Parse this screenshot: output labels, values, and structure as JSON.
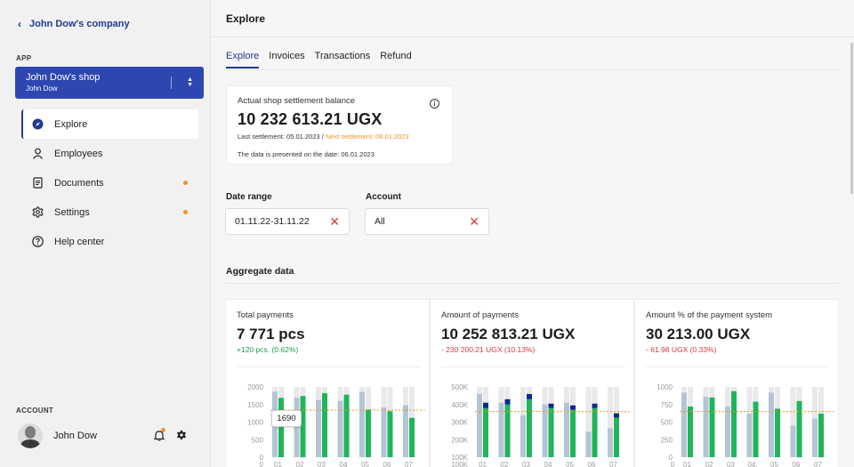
{
  "sidebar": {
    "company": "John Dow's company",
    "app_label": "APP",
    "shop": {
      "name": "John Dow's shop",
      "owner": "John Dow"
    },
    "nav": [
      {
        "label": "Explore",
        "icon": "compass-icon",
        "active": true,
        "dot": false
      },
      {
        "label": "Employees",
        "icon": "person-icon",
        "active": false,
        "dot": false
      },
      {
        "label": "Documents",
        "icon": "document-icon",
        "active": false,
        "dot": true
      },
      {
        "label": "Settings",
        "icon": "gear-icon",
        "active": false,
        "dot": true
      },
      {
        "label": "Help center",
        "icon": "help-icon",
        "active": false,
        "dot": false
      }
    ],
    "account_label": "ACCOUNT",
    "user": "John Dow"
  },
  "header": {
    "title": "Explore"
  },
  "tabs": [
    "Explore",
    "Invoices",
    "Transactions",
    "Refund"
  ],
  "balance": {
    "label": "Actual shop settlement balance",
    "amount": "10 232 613.21 UGX",
    "last": "Last settlement: 05.01.2023",
    "slash": " / ",
    "next": "Next settlement: 08.01.2023",
    "date_note": "The data is presented on the date: 06.01.2023"
  },
  "filters": {
    "date_label": "Date range",
    "date_value": "01.11.22-31.11.22",
    "account_label": "Account",
    "account_value": "All"
  },
  "aggregate": {
    "title": "Aggregate data"
  },
  "colors": {
    "accent": "#2d46b0",
    "green": "#1fb55a",
    "gray_bar": "#b4c4d4",
    "bg_bar": "#e9e9eb",
    "navy": "#0c2a8a",
    "dash": "#f39325"
  },
  "cards": [
    {
      "title": "Total payments",
      "value": "7 771 pcs",
      "delta": "+120 pcs. (0.62%)",
      "delta_type": "pos",
      "tooltip": "1690"
    },
    {
      "title": "Amount of payments",
      "value": "10 252 813.21 UGX",
      "delta": "- 230 200.21 UGX (10.13%)",
      "delta_type": "neg"
    },
    {
      "title": "Amount % of the payment system",
      "value": "30 213.00 UGX",
      "delta": "- 61.98 UGX (0.33%)",
      "delta_type": "neg"
    }
  ],
  "chart_data": [
    {
      "type": "bar",
      "categories": [
        "01",
        "02",
        "03",
        "04",
        "05",
        "06",
        "07"
      ],
      "yticks": [
        "2000",
        "1500",
        "1000",
        "500",
        "0"
      ],
      "ylim": [
        0,
        2000
      ],
      "series": [
        {
          "values": [
            1870,
            1690,
            1630,
            1600,
            1860,
            1420,
            1480
          ]
        },
        {
          "values": [
            1690,
            1740,
            1820,
            1780,
            1360,
            1310,
            1120
          ]
        },
        {
          "values": [
            2000,
            2000,
            2000,
            2000,
            2000,
            2000,
            2000
          ]
        }
      ],
      "reference_line": 1340,
      "tooltip_value": "1690"
    },
    {
      "type": "bar",
      "categories": [
        "01",
        "02",
        "03",
        "04",
        "05",
        "06",
        "07"
      ],
      "yticks": [
        "500K",
        "400K",
        "300K",
        "200K",
        "100K"
      ],
      "ylim": [
        100000,
        500000
      ],
      "series": [
        {
          "values": [
            460000,
            410000,
            340000,
            400000,
            410000,
            245000,
            265000
          ]
        },
        {
          "values": [
            380000,
            400000,
            430000,
            380000,
            370000,
            380000,
            325000
          ]
        },
        {
          "values": [
            30000,
            30000,
            30000,
            25000,
            25000,
            25000,
            25000
          ]
        },
        {
          "values": [
            500000,
            500000,
            500000,
            500000,
            500000,
            500000,
            500000
          ]
        }
      ],
      "reference_line": 360000
    },
    {
      "type": "bar",
      "categories": [
        "0",
        "01",
        "02",
        "03",
        "04.",
        "05",
        "06",
        "07"
      ],
      "yticks": [
        "1000",
        "750",
        "500",
        "250",
        "0"
      ],
      "ylim": [
        0,
        1000
      ],
      "series": [
        {
          "values": [
            920,
            860,
            720,
            620,
            920,
            450,
            550
          ]
        },
        {
          "values": [
            720,
            850,
            940,
            790,
            690,
            800,
            620
          ]
        },
        {
          "values": [
            1000,
            1000,
            1000,
            1000,
            1000,
            1000,
            1000
          ]
        }
      ],
      "reference_line": 650
    }
  ]
}
